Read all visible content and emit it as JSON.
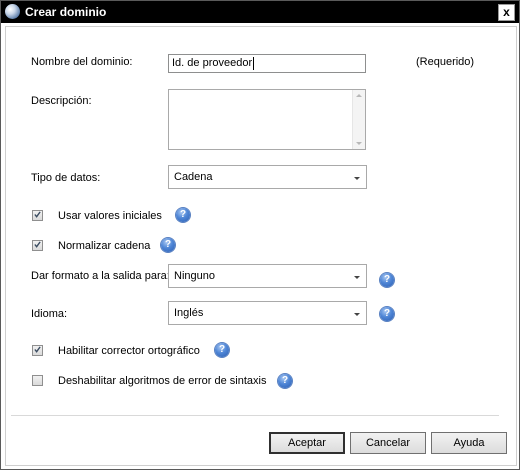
{
  "window": {
    "title": "Crear dominio",
    "close_glyph": "x",
    "icon": "app-globe-icon"
  },
  "form": {
    "domain_name": {
      "label": "Nombre del dominio:",
      "value": "Id. de proveedor",
      "required_note": "(Requerido)"
    },
    "description": {
      "label": "Descripción:",
      "value": ""
    },
    "data_type": {
      "label": "Tipo de datos:",
      "selected": "Cadena"
    },
    "use_initial_values": {
      "label": "Usar valores iniciales",
      "checked": true
    },
    "normalize_string": {
      "label": "Normalizar cadena",
      "checked": true
    },
    "output_format": {
      "label": "Dar formato a la salida para:",
      "selected": "Ninguno"
    },
    "language": {
      "label": "Idioma:",
      "selected": "Inglés"
    },
    "spell_checker": {
      "label": "Habilitar corrector ortográfico",
      "checked": true
    },
    "disable_syntax_error": {
      "label": "Deshabilitar algoritmos de error de sintaxis",
      "checked": false
    }
  },
  "help_glyph": "?",
  "buttons": {
    "ok": "Aceptar",
    "cancel": "Cancelar",
    "help": "Ayuda"
  }
}
